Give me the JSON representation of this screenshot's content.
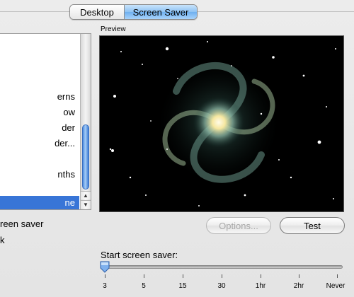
{
  "tabs": [
    {
      "label": "Desktop",
      "selected": false
    },
    {
      "label": "Screen Saver",
      "selected": true
    }
  ],
  "list": {
    "items": [
      {
        "label": "erns",
        "selected": false
      },
      {
        "label": "ow",
        "selected": false
      },
      {
        "label": "der",
        "selected": false
      },
      {
        "label": "der...",
        "selected": false
      },
      {
        "label": "",
        "selected": false
      },
      {
        "label": "nths",
        "selected": false
      },
      {
        "label": "",
        "selected": false
      },
      {
        "label": "",
        "selected": false
      },
      {
        "label": "ne",
        "selected": true
      }
    ],
    "scroll_up_glyph": "▲",
    "scroll_down_glyph": "▼"
  },
  "left_labels": {
    "random_option": "reen saver",
    "clock_option": "k"
  },
  "preview": {
    "label": "Preview",
    "image": "spiral-galaxy-starfield"
  },
  "buttons": {
    "options_label": "Options...",
    "options_enabled": false,
    "test_label": "Test"
  },
  "slider": {
    "label": "Start screen saver:",
    "ticks": [
      "3",
      "5",
      "15",
      "30",
      "1hr",
      "2hr",
      "Never"
    ],
    "selected_index": 0
  },
  "colors": {
    "selection_blue": "#3875d7",
    "tab_selected_blue": "#8ec2f3",
    "window_bg": "#e8e8e8"
  }
}
